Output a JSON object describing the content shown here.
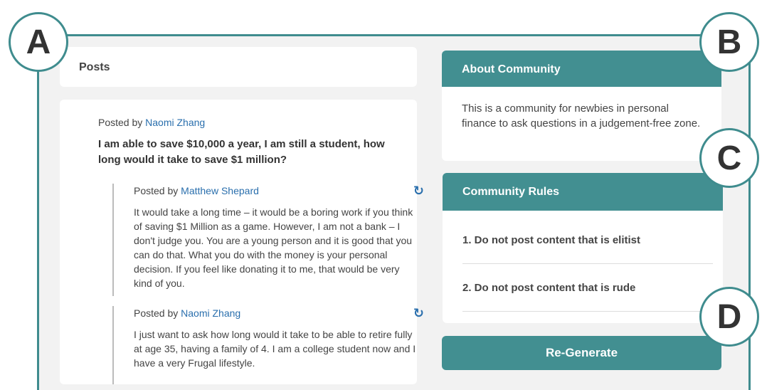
{
  "badges": [
    "A",
    "B",
    "C",
    "D"
  ],
  "posts": {
    "header": "Posts",
    "post": {
      "posted_by_prefix": "Posted by",
      "author": "Naomi Zhang",
      "title": "I am able to save $10,000 a year, I am still a student, how long would it take to save $1 million?"
    },
    "comments": [
      {
        "posted_by_prefix": "Posted by",
        "author": "Matthew Shepard",
        "body": "It would take a long time – it would be a boring work if you think of saving $1 Million as a game. However, I am not a bank – I don't judge you. You are a young person and it is good that you can do that. What you do with the money is your personal decision. If you feel like donating it to me, that would be very kind of you."
      },
      {
        "posted_by_prefix": "Posted by",
        "author": "Naomi Zhang",
        "body": "I just want to ask how long would it take to be able to retire fully at age 35, having a family of 4. I am a college student now and I have a very Frugal lifestyle."
      }
    ]
  },
  "about": {
    "title": "About Community",
    "description": "This is a community for newbies in personal finance to ask questions in a judgement-free zone."
  },
  "rules": {
    "title": "Community Rules",
    "items": [
      "1. Do not post content that is elitist",
      "2. Do not post content that is rude"
    ]
  },
  "actions": {
    "regenerate_label": "Re-Generate"
  },
  "icons": {
    "refresh": "refresh-icon"
  },
  "colors": {
    "accent": "#428f91",
    "link": "#2a6fad",
    "frame": "#3f8c8e"
  }
}
